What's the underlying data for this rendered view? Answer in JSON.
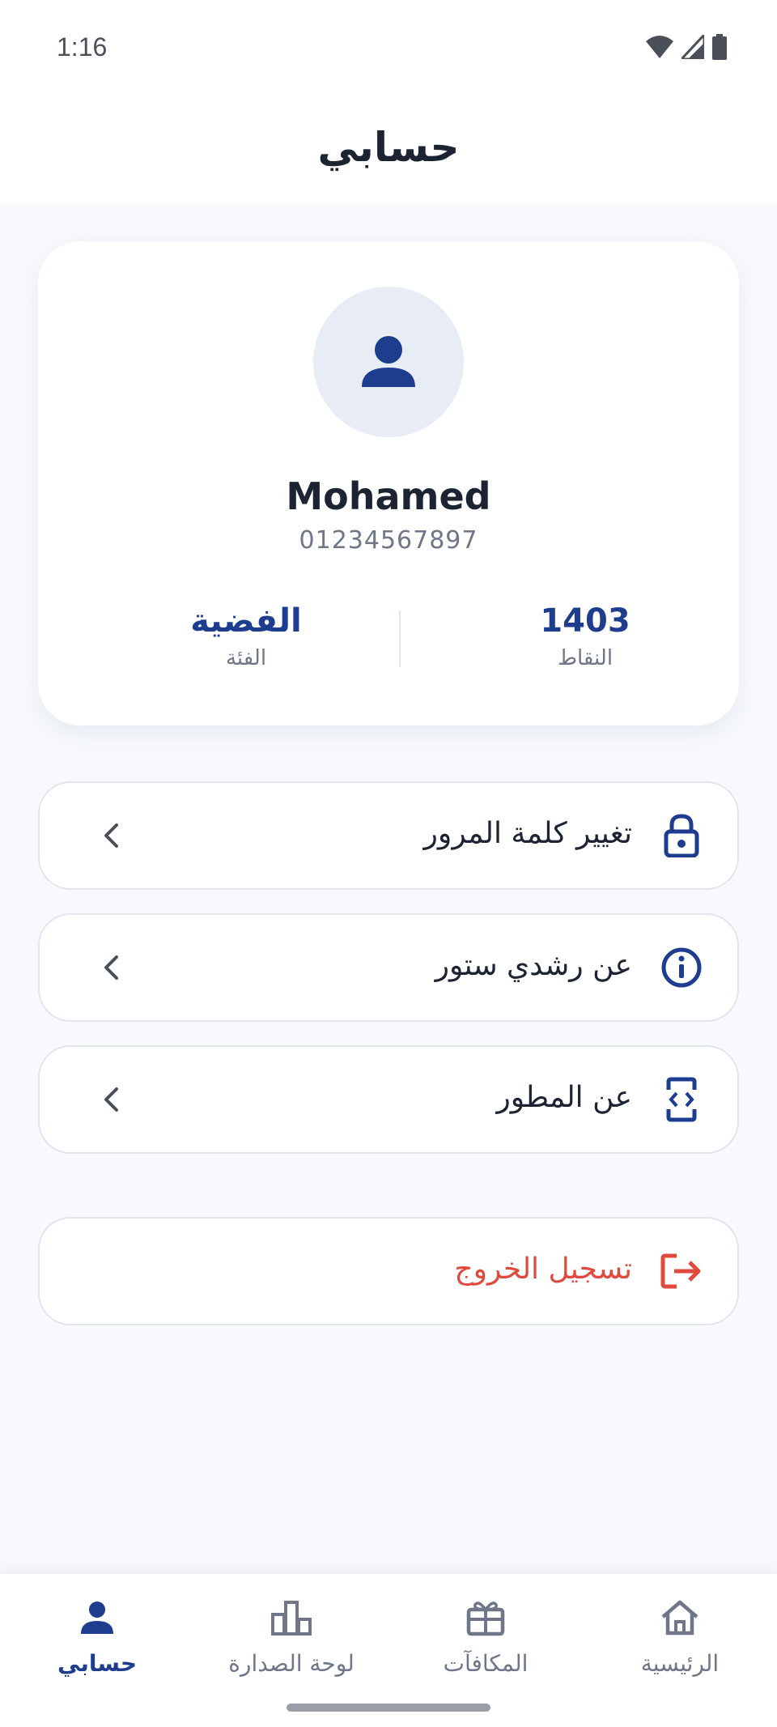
{
  "status_bar": {
    "time": "1:16"
  },
  "header": {
    "title": "حسابي"
  },
  "profile": {
    "name": "Mohamed",
    "phone": "01234567897",
    "points_value": "1403",
    "points_label": "النقاط",
    "tier_value": "الفضية",
    "tier_label": "الفئة"
  },
  "menu": {
    "change_password": "تغيير كلمة المرور",
    "about_store": "عن رشدي ستور",
    "about_developer": "عن المطور",
    "logout": "تسجيل الخروج"
  },
  "nav": {
    "home": "الرئيسية",
    "rewards": "المكافآت",
    "leaderboard": "لوحة الصدارة",
    "account": "حسابي"
  },
  "colors": {
    "primary": "#1f3d8f",
    "danger": "#e04a3c",
    "muted": "#6e7687"
  }
}
